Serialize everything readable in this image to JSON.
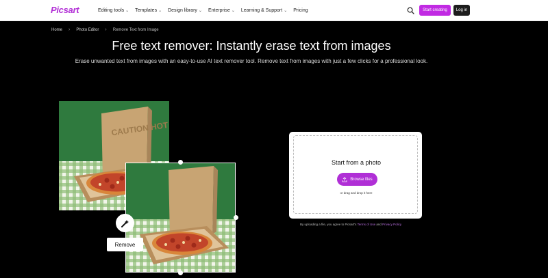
{
  "header": {
    "logo": "Picsart",
    "nav": [
      {
        "label": "Editing tools",
        "chevron": true
      },
      {
        "label": "Templates",
        "chevron": true
      },
      {
        "label": "Design library",
        "chevron": true
      },
      {
        "label": "Enterprise",
        "chevron": true
      },
      {
        "label": "Learning & Support",
        "chevron": true
      },
      {
        "label": "Pricing",
        "chevron": false
      }
    ],
    "search_icon": "search-icon",
    "start_creating": "Start creating",
    "login": "Log in"
  },
  "breadcrumb": [
    "Home",
    "Photo Editor",
    "Remove Text from Image"
  ],
  "hero": {
    "title": "Free text remover: Instantly erase text from images",
    "subtitle": "Erase unwanted text from images with an easy-to-use AI text remover tool. Remove text from images with just a few clicks for a professional look."
  },
  "demo": {
    "before_box_text": "CAUTION HOT",
    "remove_label": "Remove",
    "magic_icon": "magic-wand-icon"
  },
  "upload": {
    "title": "Start from a photo",
    "browse": "Browse files",
    "drag_hint": "or drag and drop it here",
    "legal_prefix": "By uploading a file, you agree to Picsart's",
    "terms": "Terms of Use",
    "and": "and",
    "privacy": "Privacy Policy"
  },
  "colors": {
    "brand": "#c12ae3",
    "background": "#000000",
    "card": "#ffffff"
  }
}
